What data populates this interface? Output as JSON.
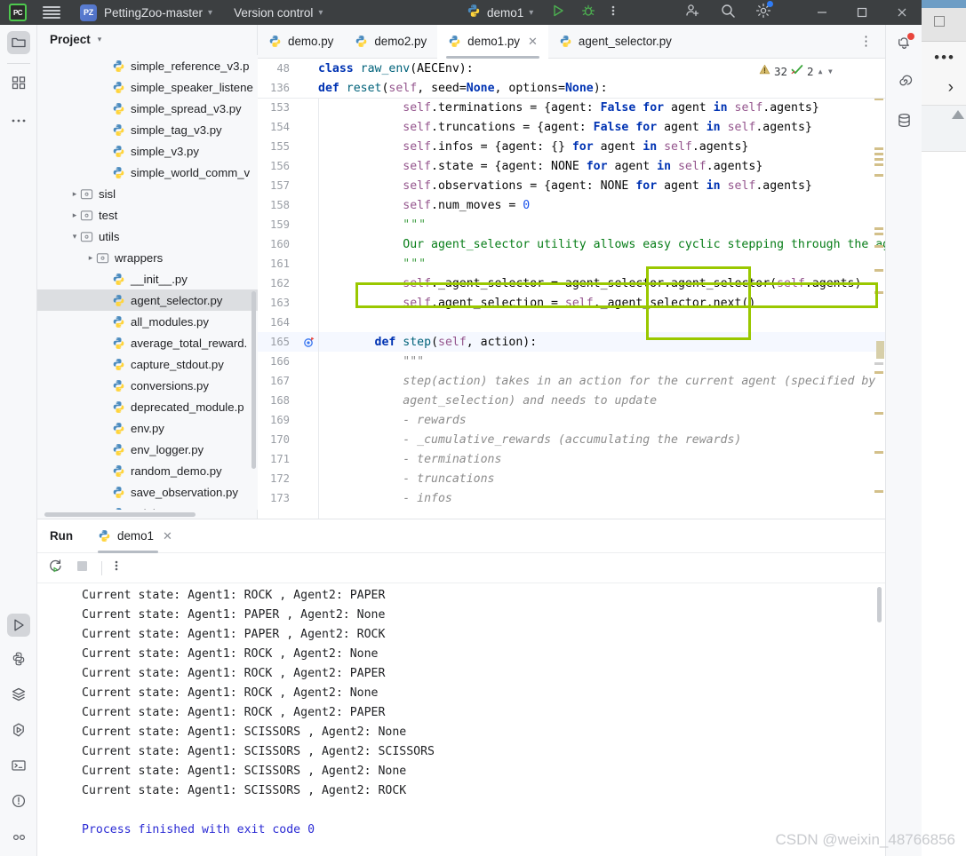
{
  "titlebar": {
    "logo_text": "PC",
    "project_name": "PettingZoo-master",
    "version_control": "Version control",
    "run_config": "demo1",
    "icons": [
      "hamburger-icon",
      "project-chevron-icon",
      "vcs-chevron-icon",
      "run-icon",
      "debug-icon",
      "more-vertical-icon",
      "add-user-icon",
      "search-icon",
      "settings-gear-icon"
    ],
    "window_buttons": [
      "minimize",
      "maximize",
      "close"
    ]
  },
  "left_stripe": {
    "top": [
      "project-folder-icon",
      "structure-icon",
      "more-tool-windows-icon"
    ],
    "bottom": [
      "run-icon",
      "python-console-icon",
      "services-icon",
      "debug-icon",
      "terminal-icon",
      "problems-icon",
      "profiler-icon"
    ]
  },
  "right_stripe": {
    "items": [
      "notifications-bell-icon",
      "ai-assistant-icon",
      "database-icon"
    ]
  },
  "project": {
    "title": "Project",
    "collapse_caret": "v",
    "tree": [
      {
        "label": "simple_reference_v3.p",
        "type": "py",
        "indent": 4,
        "arrow": "",
        "selected": false
      },
      {
        "label": "simple_speaker_listene",
        "type": "py",
        "indent": 4,
        "arrow": "",
        "selected": false
      },
      {
        "label": "simple_spread_v3.py",
        "type": "py",
        "indent": 4,
        "arrow": "",
        "selected": false
      },
      {
        "label": "simple_tag_v3.py",
        "type": "py",
        "indent": 4,
        "arrow": "",
        "selected": false
      },
      {
        "label": "simple_v3.py",
        "type": "py",
        "indent": 4,
        "arrow": "",
        "selected": false
      },
      {
        "label": "simple_world_comm_v",
        "type": "py",
        "indent": 4,
        "arrow": "",
        "selected": false
      },
      {
        "label": "sisl",
        "type": "folder",
        "indent": 2,
        "arrow": ">",
        "selected": false
      },
      {
        "label": "test",
        "type": "folder",
        "indent": 2,
        "arrow": ">",
        "selected": false
      },
      {
        "label": "utils",
        "type": "folder",
        "indent": 2,
        "arrow": "v",
        "selected": false
      },
      {
        "label": "wrappers",
        "type": "folder",
        "indent": 3,
        "arrow": ">",
        "selected": false
      },
      {
        "label": "__init__.py",
        "type": "py",
        "indent": 4,
        "arrow": "",
        "selected": false
      },
      {
        "label": "agent_selector.py",
        "type": "py",
        "indent": 4,
        "arrow": "",
        "selected": true
      },
      {
        "label": "all_modules.py",
        "type": "py",
        "indent": 4,
        "arrow": "",
        "selected": false
      },
      {
        "label": "average_total_reward.",
        "type": "py",
        "indent": 4,
        "arrow": "",
        "selected": false
      },
      {
        "label": "capture_stdout.py",
        "type": "py",
        "indent": 4,
        "arrow": "",
        "selected": false
      },
      {
        "label": "conversions.py",
        "type": "py",
        "indent": 4,
        "arrow": "",
        "selected": false
      },
      {
        "label": "deprecated_module.p",
        "type": "py",
        "indent": 4,
        "arrow": "",
        "selected": false
      },
      {
        "label": "env.py",
        "type": "py",
        "indent": 4,
        "arrow": "",
        "selected": false
      },
      {
        "label": "env_logger.py",
        "type": "py",
        "indent": 4,
        "arrow": "",
        "selected": false
      },
      {
        "label": "random_demo.py",
        "type": "py",
        "indent": 4,
        "arrow": "",
        "selected": false
      },
      {
        "label": "save_observation.py",
        "type": "py",
        "indent": 4,
        "arrow": "",
        "selected": false
      },
      {
        "label": "__init__.py",
        "type": "py",
        "indent": 4,
        "arrow": "",
        "selected": false
      }
    ]
  },
  "editor_tabs": {
    "tabs": [
      {
        "label": "demo.py",
        "active": false,
        "closable": false
      },
      {
        "label": "demo2.py",
        "active": false,
        "closable": false
      },
      {
        "label": "demo1.py",
        "active": true,
        "closable": true
      },
      {
        "label": "agent_selector.py",
        "active": false,
        "closable": false
      }
    ],
    "more_icon": "more-vertical-icon"
  },
  "inspections": {
    "warning_icon": "warning-triangle-icon",
    "warning_count": "32",
    "ok_icon": "green-check-icon",
    "ok_count": "2",
    "up_icon": "chevron-up-icon",
    "down_icon": "chevron-down-icon"
  },
  "code": {
    "sticky": [
      {
        "num": "48",
        "gutter": "",
        "segs": [
          {
            "t": "class ",
            "c": "kw"
          },
          {
            "t": "raw_env",
            "c": "fn"
          },
          {
            "t": "(AECEnv):",
            "c": "pln"
          }
        ],
        "indent": "    "
      },
      {
        "num": "136",
        "gutter": "",
        "segs": [
          {
            "t": "def ",
            "c": "kw"
          },
          {
            "t": "reset",
            "c": "fn"
          },
          {
            "t": "(",
            "c": "pln"
          },
          {
            "t": "self",
            "c": "slf"
          },
          {
            "t": ", seed=",
            "c": "pln"
          },
          {
            "t": "None",
            "c": "kw"
          },
          {
            "t": ", options=",
            "c": "pln"
          },
          {
            "t": "None",
            "c": "kw"
          },
          {
            "t": "):",
            "c": "pln"
          }
        ],
        "indent": "        "
      }
    ],
    "lines": [
      {
        "num": "153",
        "gutter": "",
        "current": false,
        "segs": [
          {
            "t": "            ",
            "c": "pln"
          },
          {
            "t": "self",
            "c": "slf"
          },
          {
            "t": ".terminations",
            "c": "pln"
          },
          {
            "t": " = {agent: ",
            "c": "pln"
          },
          {
            "t": "False",
            "c": "kw"
          },
          {
            "t": " ",
            "c": "pln"
          },
          {
            "t": "for",
            "c": "kw"
          },
          {
            "t": " agent ",
            "c": "pln"
          },
          {
            "t": "in",
            "c": "kw"
          },
          {
            "t": " ",
            "c": "pln"
          },
          {
            "t": "self",
            "c": "slf"
          },
          {
            "t": ".agents}",
            "c": "pln"
          }
        ]
      },
      {
        "num": "154",
        "gutter": "",
        "current": false,
        "segs": [
          {
            "t": "            ",
            "c": "pln"
          },
          {
            "t": "self",
            "c": "slf"
          },
          {
            "t": ".truncations",
            "c": "pln"
          },
          {
            "t": " = {agent: ",
            "c": "pln"
          },
          {
            "t": "False",
            "c": "kw"
          },
          {
            "t": " ",
            "c": "pln"
          },
          {
            "t": "for",
            "c": "kw"
          },
          {
            "t": " agent ",
            "c": "pln"
          },
          {
            "t": "in",
            "c": "kw"
          },
          {
            "t": " ",
            "c": "pln"
          },
          {
            "t": "self",
            "c": "slf"
          },
          {
            "t": ".agents}",
            "c": "pln"
          }
        ]
      },
      {
        "num": "155",
        "gutter": "",
        "current": false,
        "segs": [
          {
            "t": "            ",
            "c": "pln"
          },
          {
            "t": "self",
            "c": "slf"
          },
          {
            "t": ".infos",
            "c": "pln"
          },
          {
            "t": " = {agent: {} ",
            "c": "pln"
          },
          {
            "t": "for",
            "c": "kw"
          },
          {
            "t": " agent ",
            "c": "pln"
          },
          {
            "t": "in",
            "c": "kw"
          },
          {
            "t": " ",
            "c": "pln"
          },
          {
            "t": "self",
            "c": "slf"
          },
          {
            "t": ".agents}",
            "c": "pln"
          }
        ]
      },
      {
        "num": "156",
        "gutter": "",
        "current": false,
        "segs": [
          {
            "t": "            ",
            "c": "pln"
          },
          {
            "t": "self",
            "c": "slf"
          },
          {
            "t": ".state",
            "c": "pln"
          },
          {
            "t": " = {agent: NONE ",
            "c": "pln"
          },
          {
            "t": "for",
            "c": "kw"
          },
          {
            "t": " agent ",
            "c": "pln"
          },
          {
            "t": "in",
            "c": "kw"
          },
          {
            "t": " ",
            "c": "pln"
          },
          {
            "t": "self",
            "c": "slf"
          },
          {
            "t": ".agents}",
            "c": "pln"
          }
        ]
      },
      {
        "num": "157",
        "gutter": "",
        "current": false,
        "segs": [
          {
            "t": "            ",
            "c": "pln"
          },
          {
            "t": "self",
            "c": "slf"
          },
          {
            "t": ".observations",
            "c": "pln"
          },
          {
            "t": " = {agent: NONE ",
            "c": "pln"
          },
          {
            "t": "for",
            "c": "kw"
          },
          {
            "t": " agent ",
            "c": "pln"
          },
          {
            "t": "in",
            "c": "kw"
          },
          {
            "t": " ",
            "c": "pln"
          },
          {
            "t": "self",
            "c": "slf"
          },
          {
            "t": ".agents}",
            "c": "pln"
          }
        ]
      },
      {
        "num": "158",
        "gutter": "",
        "current": false,
        "segs": [
          {
            "t": "            ",
            "c": "pln"
          },
          {
            "t": "self",
            "c": "slf"
          },
          {
            "t": ".num_moves",
            "c": "pln"
          },
          {
            "t": " = ",
            "c": "pln"
          },
          {
            "t": "0",
            "c": "num"
          }
        ]
      },
      {
        "num": "159",
        "gutter": "",
        "current": false,
        "segs": [
          {
            "t": "            ",
            "c": "pln"
          },
          {
            "t": "\"\"\"",
            "c": "dots3"
          }
        ]
      },
      {
        "num": "160",
        "gutter": "",
        "current": false,
        "segs": [
          {
            "t": "            ",
            "c": "pln"
          },
          {
            "t": "Our agent_selector utility allows easy cyclic stepping through the agen",
            "c": "str"
          }
        ]
      },
      {
        "num": "161",
        "gutter": "",
        "current": false,
        "segs": [
          {
            "t": "            ",
            "c": "pln"
          },
          {
            "t": "\"\"\"",
            "c": "dots3"
          }
        ]
      },
      {
        "num": "162",
        "gutter": "",
        "current": false,
        "segs": [
          {
            "t": "            ",
            "c": "pln"
          },
          {
            "t": "self",
            "c": "slf"
          },
          {
            "t": "._agent_selector",
            "c": "pln"
          },
          {
            "t": " = agent_selector.agent_selector(",
            "c": "pln"
          },
          {
            "t": "self",
            "c": "slf"
          },
          {
            "t": ".agents)",
            "c": "pln"
          }
        ]
      },
      {
        "num": "163",
        "gutter": "",
        "current": false,
        "segs": [
          {
            "t": "            ",
            "c": "pln"
          },
          {
            "t": "self",
            "c": "slf"
          },
          {
            "t": ".agent_selection",
            "c": "pln"
          },
          {
            "t": " = ",
            "c": "pln"
          },
          {
            "t": "self",
            "c": "slf"
          },
          {
            "t": "._agent_selector.next()",
            "c": "pln"
          }
        ]
      },
      {
        "num": "164",
        "gutter": "",
        "current": false,
        "segs": []
      },
      {
        "num": "165",
        "gutter": "breakpoint-target-icon",
        "current": true,
        "segs": [
          {
            "t": "        ",
            "c": "pln"
          },
          {
            "t": "def ",
            "c": "kw"
          },
          {
            "t": "step",
            "c": "fn"
          },
          {
            "t": "(",
            "c": "pln"
          },
          {
            "t": "self",
            "c": "slf"
          },
          {
            "t": ", action):",
            "c": "pln"
          }
        ]
      },
      {
        "num": "166",
        "gutter": "",
        "current": false,
        "segs": [
          {
            "t": "            ",
            "c": "pln"
          },
          {
            "t": "\"\"\"",
            "c": "doc"
          }
        ]
      },
      {
        "num": "167",
        "gutter": "",
        "current": false,
        "segs": [
          {
            "t": "            step(action) takes in an action for the current agent (specified by",
            "c": "doc"
          }
        ]
      },
      {
        "num": "168",
        "gutter": "",
        "current": false,
        "segs": [
          {
            "t": "            agent_selection) and needs to update",
            "c": "doc"
          }
        ]
      },
      {
        "num": "169",
        "gutter": "",
        "current": false,
        "segs": [
          {
            "t": "            - rewards",
            "c": "doc"
          }
        ]
      },
      {
        "num": "170",
        "gutter": "",
        "current": false,
        "segs": [
          {
            "t": "            - _cumulative_rewards (accumulating the rewards)",
            "c": "doc"
          }
        ]
      },
      {
        "num": "171",
        "gutter": "",
        "current": false,
        "segs": [
          {
            "t": "            - terminations",
            "c": "doc"
          }
        ]
      },
      {
        "num": "172",
        "gutter": "",
        "current": false,
        "segs": [
          {
            "t": "            - truncations",
            "c": "doc"
          }
        ]
      },
      {
        "num": "173",
        "gutter": "",
        "current": false,
        "segs": [
          {
            "t": "            - infos",
            "c": "doc"
          }
        ]
      }
    ],
    "annotation_color": "#9ac800"
  },
  "run_panel": {
    "title": "Run",
    "tab_label": "demo1",
    "tab_close": "x",
    "tools": [
      "rerun-icon",
      "stop-icon",
      "more-vertical-icon"
    ],
    "console_lines": [
      {
        "text": "Current state: Agent1: ROCK , Agent2: PAPER",
        "kind": "out"
      },
      {
        "text": "Current state: Agent1: PAPER , Agent2: None",
        "kind": "out"
      },
      {
        "text": "Current state: Agent1: PAPER , Agent2: ROCK",
        "kind": "out"
      },
      {
        "text": "Current state: Agent1: ROCK , Agent2: None",
        "kind": "out"
      },
      {
        "text": "Current state: Agent1: ROCK , Agent2: PAPER",
        "kind": "out"
      },
      {
        "text": "Current state: Agent1: ROCK , Agent2: None",
        "kind": "out"
      },
      {
        "text": "Current state: Agent1: ROCK , Agent2: PAPER",
        "kind": "out"
      },
      {
        "text": "Current state: Agent1: SCISSORS , Agent2: None",
        "kind": "out"
      },
      {
        "text": "Current state: Agent1: SCISSORS , Agent2: SCISSORS",
        "kind": "out"
      },
      {
        "text": "Current state: Agent1: SCISSORS , Agent2: None",
        "kind": "out"
      },
      {
        "text": "Current state: Agent1: SCISSORS , Agent2: ROCK",
        "kind": "out"
      },
      {
        "text": "",
        "kind": "out"
      },
      {
        "text": "Process finished with exit code 0",
        "kind": "exit"
      }
    ]
  },
  "watermark": "CSDN @weixin_48766856",
  "colors": {
    "titlebar_bg": "#3c3f41",
    "panel_bg": "#f7f8fa",
    "editor_bg": "#ffffff",
    "selection_bg": "#dcdee1",
    "annotation": "#9ac800",
    "exit_text": "#2b2bd4"
  }
}
